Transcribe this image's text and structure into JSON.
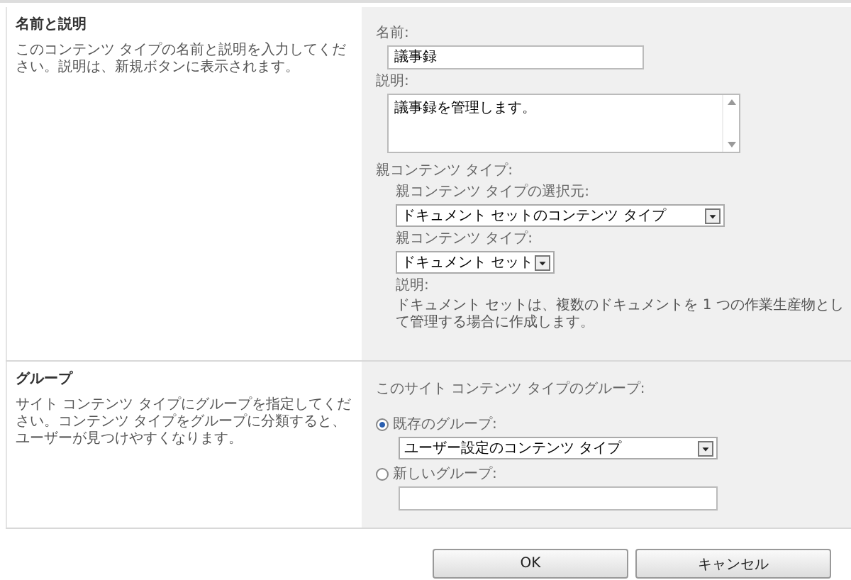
{
  "sections": [
    {
      "title": "名前と説明",
      "description": "このコンテンツ タイプの名前と説明を入力してください。説明は、新規ボタンに表示されます。",
      "name": {
        "label": "名前:",
        "value": "議事録"
      },
      "desc": {
        "label": "説明:",
        "value": "議事録を管理します。"
      },
      "parent": {
        "label": "親コンテンツ タイプ:",
        "source_label": "親コンテンツ タイプの選択元:",
        "source_value": "ドキュメント セットのコンテンツ タイプ",
        "type_label": "親コンテンツ タイプ:",
        "type_value": "ドキュメント セット",
        "note_label": "説明:",
        "note": "ドキュメント セットは、複数のドキュメントを 1 つの作業生産物として管理する場合に作成します。"
      }
    },
    {
      "title": "グループ",
      "description": "サイト コンテンツ タイプにグループを指定してください。コンテンツ タイプをグループに分類すると、ユーザーが見つけやすくなります。",
      "group_label": "このサイト コンテンツ タイプのグループ:",
      "options": [
        {
          "label": "既存のグループ:",
          "selected": true,
          "kind": "select",
          "value": "ユーザー設定のコンテンツ タイプ"
        },
        {
          "label": "新しいグループ:",
          "selected": false,
          "kind": "text"
        }
      ]
    }
  ],
  "buttons": [
    "OK",
    "キャンセル"
  ]
}
